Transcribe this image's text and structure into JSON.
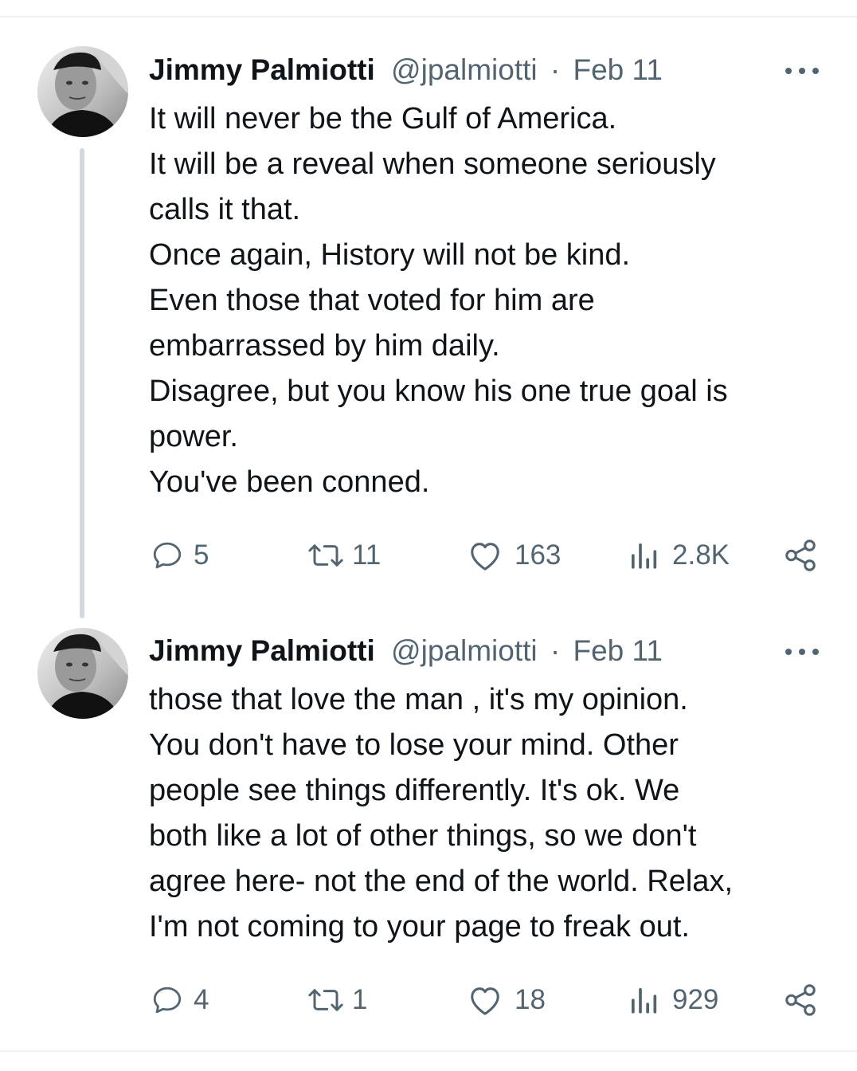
{
  "tweets": [
    {
      "author_name": "Jimmy Palmiotti",
      "handle": "@jpalmiotti",
      "separator": "·",
      "date": "Feb 11",
      "text_lines": [
        "It will never be the Gulf of America.",
        "It will be a reveal when someone seriously",
        "calls it that.",
        "Once again, History will not be kind.",
        "Even those that voted for him are",
        "embarrassed by him daily.",
        "Disagree, but you know his one true goal is",
        "power.",
        "You've been conned."
      ],
      "replies": "5",
      "retweets": "11",
      "likes": "163",
      "views": "2.8K"
    },
    {
      "author_name": "Jimmy Palmiotti",
      "handle": "@jpalmiotti",
      "separator": "·",
      "date": "Feb 11",
      "text_lines": [
        "those that love the man , it's my opinion.",
        "You don't have to lose your mind. Other",
        "people see things differently. It's ok. We",
        "both like a lot of other things, so we don't",
        "agree here- not the end of the world. Relax,",
        "I'm not coming to your page to freak out."
      ],
      "replies": "4",
      "retweets": "1",
      "likes": "18",
      "views": "929"
    }
  ],
  "icons": {
    "avatar": "avatar-photo",
    "more": "more-dots-icon",
    "reply": "reply-bubble-icon",
    "retweet": "retweet-icon",
    "like": "heart-icon",
    "views": "views-bar-chart-icon",
    "share": "share-icon"
  },
  "colors": {
    "text_primary": "#0f1419",
    "text_secondary": "#536471",
    "thread_line": "#cfd9de",
    "divider": "#eff3f4"
  }
}
